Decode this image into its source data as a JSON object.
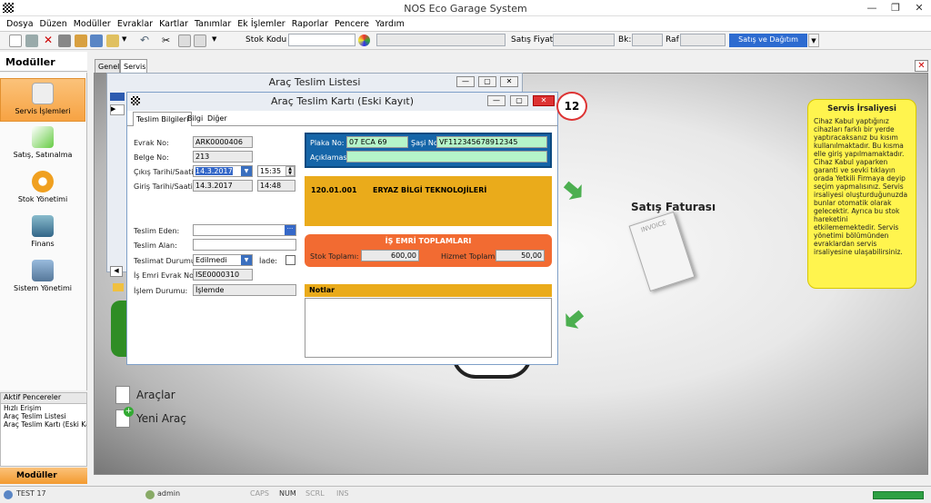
{
  "app": {
    "title": "NOS Eco Garage System"
  },
  "menu": [
    "Dosya",
    "Düzen",
    "Modüller",
    "Evraklar",
    "Kartlar",
    "Tanımlar",
    "Ek İşlemler",
    "Raporlar",
    "Pencere",
    "Yardım"
  ],
  "toolbar": {
    "stok_kodu_label": "Stok Kodu",
    "satis_fiyati_label": "Satış Fiyatı",
    "bk_label": "Bk:",
    "raf_label": "Raf",
    "satis_dagitim_label": "Satış ve Dağıtım"
  },
  "left": {
    "header": "Modüller",
    "modules": [
      "Servis İşlemleri",
      "Satış, Satınalma",
      "Stok Yönetimi",
      "Finans",
      "Sistem Yönetimi"
    ],
    "aktif_title": "Aktif Pencereler",
    "aktif_items": [
      "Hızlı Erişim",
      "Araç Teslim Listesi",
      "Araç Teslim Kartı (Eski Ka"
    ],
    "moduller_btn": "Modüller"
  },
  "tabs": [
    "Genel",
    "Servis"
  ],
  "status": {
    "user": "TEST 17",
    "admin": "admin",
    "caps": "CAPS",
    "num": "NUM",
    "scrl": "SCRL",
    "ins": "INS"
  },
  "list_window": {
    "title": "Araç Teslim Listesi"
  },
  "card": {
    "title": "Araç Teslim Kartı (Eski Kayıt)",
    "badge": "12",
    "tabs": [
      "Teslim Bilgileri",
      "Bilgi",
      "Diğer"
    ],
    "fields": {
      "evrak_no_label": "Evrak No:",
      "evrak_no": "ARK0000406",
      "belge_no_label": "Belge No:",
      "belge_no": "213",
      "cikis_label": "Çıkış Tarihi/Saati:",
      "cikis_tarih": "14.3.2017",
      "cikis_saat": "15:35",
      "giris_label": "Giriş Tarihi/Saati:",
      "giris_tarih": "14.3.2017",
      "giris_saat": "14:48",
      "teslim_eden_label": "Teslim Eden:",
      "teslim_alan_label": "Teslim Alan:",
      "teslimat_durumu_label": "Teslimat Durumu:",
      "teslimat_durumu": "Edilmedi",
      "iade_label": "İade:",
      "is_emri_evrak_label": "İş Emri Evrak No:",
      "is_emri_evrak": "ISE0000310",
      "islem_durumu_label": "İşlem Durumu:",
      "islem_durumu": "İşlemde"
    },
    "vehicle": {
      "plaka_label": "Plaka No:",
      "plaka": "07 ECA 69",
      "sasi_label": "Şaşi No:",
      "sasi": "VF112345678912345",
      "aciklama_label": "Açıklaması:"
    },
    "customer": {
      "code": "120.01.001",
      "name": "ERYAZ BİLGİ TEKNOLOJİLERİ"
    },
    "totals": {
      "title": "İŞ EMRİ TOPLAMLARI",
      "stok_label": "Stok Toplamı:",
      "stok": "600,00",
      "hizmet_label": "Hizmet Toplamı:",
      "hizmet": "50,00"
    },
    "notes_label": "Notlar"
  },
  "background": {
    "satis_faturasi": "Satış Faturası",
    "invoice": "INVOICE",
    "araclar": "Araçlar",
    "yeni_arac": "Yeni Araç"
  },
  "note": {
    "title": "Servis İrsaliyesi",
    "body": "Cihaz Kabul yaptığınız cihazları farklı bir yerde yaptıracaksanız bu kısım kullanılmaktadır. Bu kısma elle giriş yapılmamaktadır. Cihaz Kabul yaparken garanti ve sevki tıklayın orada Yetkili Firmaya deyip seçim yapmalısınız. Servis irsaliyesi oluşturduğunuzda bunlar otomatik olarak gelecektir. Ayrıca bu stok hareketini etkilememektedir. Servis yönetimi bölümünden evraklardan servis irsaliyesine ulaşabilirsiniz."
  }
}
